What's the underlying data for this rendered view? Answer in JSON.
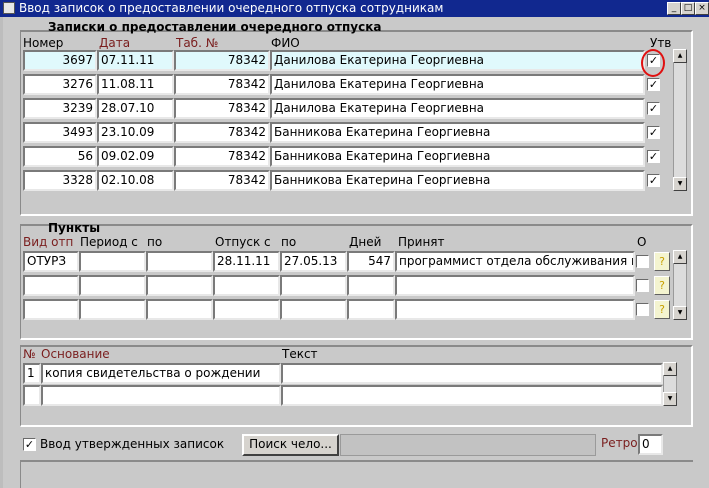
{
  "window": {
    "title": "Ввод записок о предоставлении очередного отпуска сотрудникам"
  },
  "notes": {
    "section_title": "Записки о предоставлении очередного отпуска",
    "columns": {
      "number": "Номер",
      "date": "Дата",
      "tab": "Таб. №",
      "fio": "ФИО",
      "approved": "Утв"
    },
    "rows": [
      {
        "number": "3697",
        "date": "07.11.11",
        "tab": "78342",
        "fio": "Данилова Екатерина Георгиевна",
        "approved": "✓"
      },
      {
        "number": "3276",
        "date": "11.08.11",
        "tab": "78342",
        "fio": "Данилова Екатерина Георгиевна",
        "approved": "✓"
      },
      {
        "number": "3239",
        "date": "28.07.10",
        "tab": "78342",
        "fio": "Данилова Екатерина Георгиевна",
        "approved": "✓"
      },
      {
        "number": "3493",
        "date": "23.10.09",
        "tab": "78342",
        "fio": "Банникова Екатерина Георгиевна",
        "approved": "✓"
      },
      {
        "number": "56",
        "date": "09.02.09",
        "tab": "78342",
        "fio": "Банникова Екатерина Георгиевна",
        "approved": "✓"
      },
      {
        "number": "3328",
        "date": "02.10.08",
        "tab": "78342",
        "fio": "Банникова Екатерина Георгиевна",
        "approved": "✓"
      }
    ]
  },
  "items": {
    "section_title": "Пункты",
    "columns": {
      "type": "Вид отп",
      "period_from": "Период с",
      "period_to": "по",
      "leave_from": "Отпуск с",
      "leave_to": "по",
      "days": "Дней",
      "accepted": "Принят",
      "o": "О"
    },
    "rows": [
      {
        "type": "ОТУРЗ",
        "period_from": "",
        "period_to": "",
        "leave_from": "28.11.11",
        "leave_to": "27.05.13",
        "days": "547",
        "accepted": "программист   отдела обслуживания п"
      },
      {
        "type": "",
        "period_from": "",
        "period_to": "",
        "leave_from": "",
        "leave_to": "",
        "days": "",
        "accepted": ""
      },
      {
        "type": "",
        "period_from": "",
        "period_to": "",
        "leave_from": "",
        "leave_to": "",
        "days": "",
        "accepted": ""
      }
    ],
    "help_glyph": "?"
  },
  "basis": {
    "columns": {
      "num": "№",
      "basis": "Основание",
      "text": "Текст"
    },
    "rows": [
      {
        "num": "1",
        "basis": "копия свидетельства о рождении",
        "text": ""
      },
      {
        "num": "",
        "basis": "",
        "text": ""
      }
    ]
  },
  "footer": {
    "approved_checkbox_label": "Ввод утвержденных записок",
    "approved_checked": "✓",
    "search_button": "Поиск чело...",
    "retro_label": "Ретро",
    "retro_value": "0"
  }
}
